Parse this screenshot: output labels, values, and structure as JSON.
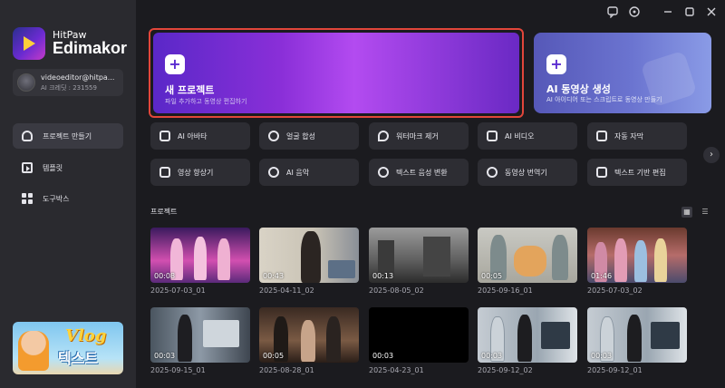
{
  "app": {
    "brand_small": "HitPaw",
    "brand_large": "Edimakor"
  },
  "account": {
    "email": "videoeditor@hitpa...",
    "credits": "AI 크레딧 : 231559"
  },
  "sidebar": {
    "items": [
      {
        "label": "프로젝트 만들기",
        "icon": "home-icon",
        "active": true
      },
      {
        "label": "템플릿",
        "icon": "template-icon",
        "active": false
      },
      {
        "label": "도구박스",
        "icon": "toolbox-icon",
        "active": false
      }
    ],
    "banner": {
      "title": "Vlog",
      "subtitle": "텍스트"
    }
  },
  "hero": {
    "new_project": {
      "title": "새 프로젝트",
      "subtitle": "파일 추가하고 동영상 편집하기"
    },
    "ai_video": {
      "title": "AI 동영상 생성",
      "subtitle": "AI 아이디어 또는 스크립트로 동영상 만들기"
    }
  },
  "tools": [
    {
      "label": "AI 아바타",
      "icon": "avatar-icon"
    },
    {
      "label": "얼굴 합성",
      "icon": "face-swap-icon"
    },
    {
      "label": "워터마크 제거",
      "icon": "watermark-remove-icon"
    },
    {
      "label": "AI 비디오",
      "icon": "ai-video-icon"
    },
    {
      "label": "자동 자막",
      "icon": "caption-icon"
    },
    {
      "label": "영상 향상기",
      "icon": "enhance-icon"
    },
    {
      "label": "AI 음악",
      "icon": "music-icon"
    },
    {
      "label": "텍스트 음성 변환",
      "icon": "tts-icon"
    },
    {
      "label": "동영상 번역기",
      "icon": "translate-icon"
    },
    {
      "label": "텍스트 기반 편집",
      "icon": "text-edit-icon"
    }
  ],
  "projects_section": {
    "title": "프로젝트"
  },
  "projects": [
    {
      "name": "2025-07-03_01",
      "duration": "00:08"
    },
    {
      "name": "2025-04-11_02",
      "duration": "00:43"
    },
    {
      "name": "2025-08-05_02",
      "duration": "00:13"
    },
    {
      "name": "2025-09-16_01",
      "duration": "00:05"
    },
    {
      "name": "2025-07-03_02",
      "duration": "01:46"
    },
    {
      "name": "2025-09-15_01",
      "duration": "00:03"
    },
    {
      "name": "2025-08-28_01",
      "duration": "00:05"
    },
    {
      "name": "2025-04-23_01",
      "duration": "00:03"
    },
    {
      "name": "2025-09-12_02",
      "duration": "00:03"
    },
    {
      "name": "2025-09-12_01",
      "duration": "00:03"
    }
  ],
  "colors": {
    "accent": "#7a2fe0",
    "highlight_border": "#e2463a",
    "background": "#1b1b1f",
    "sidebar": "#2a2a2f"
  }
}
